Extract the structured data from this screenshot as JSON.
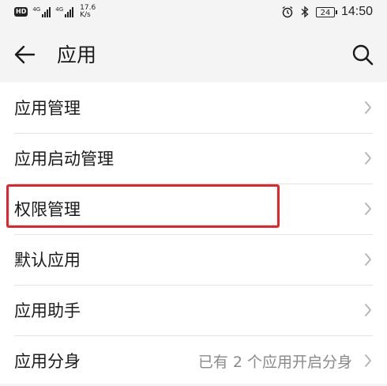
{
  "status_bar": {
    "hd_label": "HD",
    "sim1_label": "4G",
    "sim2_label": "4G",
    "net_speed_value": "17.6",
    "net_speed_unit": "K/s",
    "battery": "24",
    "time": "14:50"
  },
  "app_bar": {
    "title": "应用",
    "back_icon": "arrow-left-icon",
    "search_icon": "search-icon"
  },
  "list": {
    "items": [
      {
        "label": "应用管理",
        "value": ""
      },
      {
        "label": "应用启动管理",
        "value": ""
      },
      {
        "label": "权限管理",
        "value": ""
      },
      {
        "label": "默认应用",
        "value": ""
      },
      {
        "label": "应用助手",
        "value": ""
      },
      {
        "label": "应用分身",
        "value": "已有 2 个应用开启分身"
      }
    ]
  },
  "colors": {
    "background": "#f4f4f4",
    "list_background": "#ffffff",
    "highlight_border": "#e8212b",
    "secondary_text": "#8a8a8a"
  }
}
